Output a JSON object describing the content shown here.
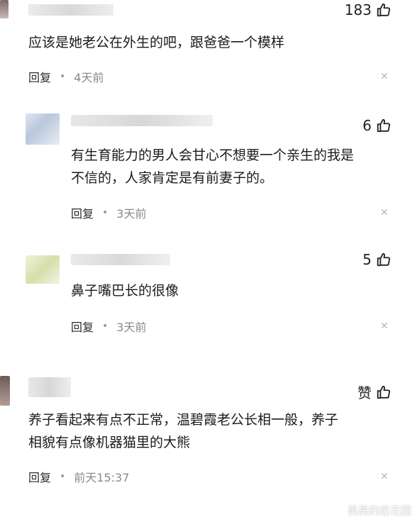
{
  "comments": [
    {
      "likes": "183",
      "text_lines": [
        "应该是她老公在外生的吧，跟爸爸一个模样"
      ],
      "reply_label": "回复",
      "time": "4天前"
    },
    {
      "likes": "6",
      "text_lines": [
        "有生育能力的男人会甘心不想要一个亲生的我是",
        "不信的，人家肯定是有前妻子的。"
      ],
      "reply_label": "回复",
      "time": "3天前"
    },
    {
      "likes": "5",
      "text_lines": [
        "鼻子嘴巴长的很像"
      ],
      "reply_label": "回复",
      "time": "3天前"
    },
    {
      "likes": "赞",
      "text_lines": [
        "养子看起来有点不正常，温碧霞老公长相一般，养子",
        "相貌有点像机器猫里的大熊"
      ],
      "reply_label": "回复",
      "time": "前天15:37"
    }
  ],
  "icons": {
    "like": "thumbs-up-icon",
    "close": "close-icon",
    "watermark": "chat-bubble-icon"
  },
  "watermark_text": "吴昊的后花园",
  "colors": {
    "text": "#1b1b1b",
    "meta_time": "#8a8a8a",
    "close": "#b8b8b8"
  }
}
